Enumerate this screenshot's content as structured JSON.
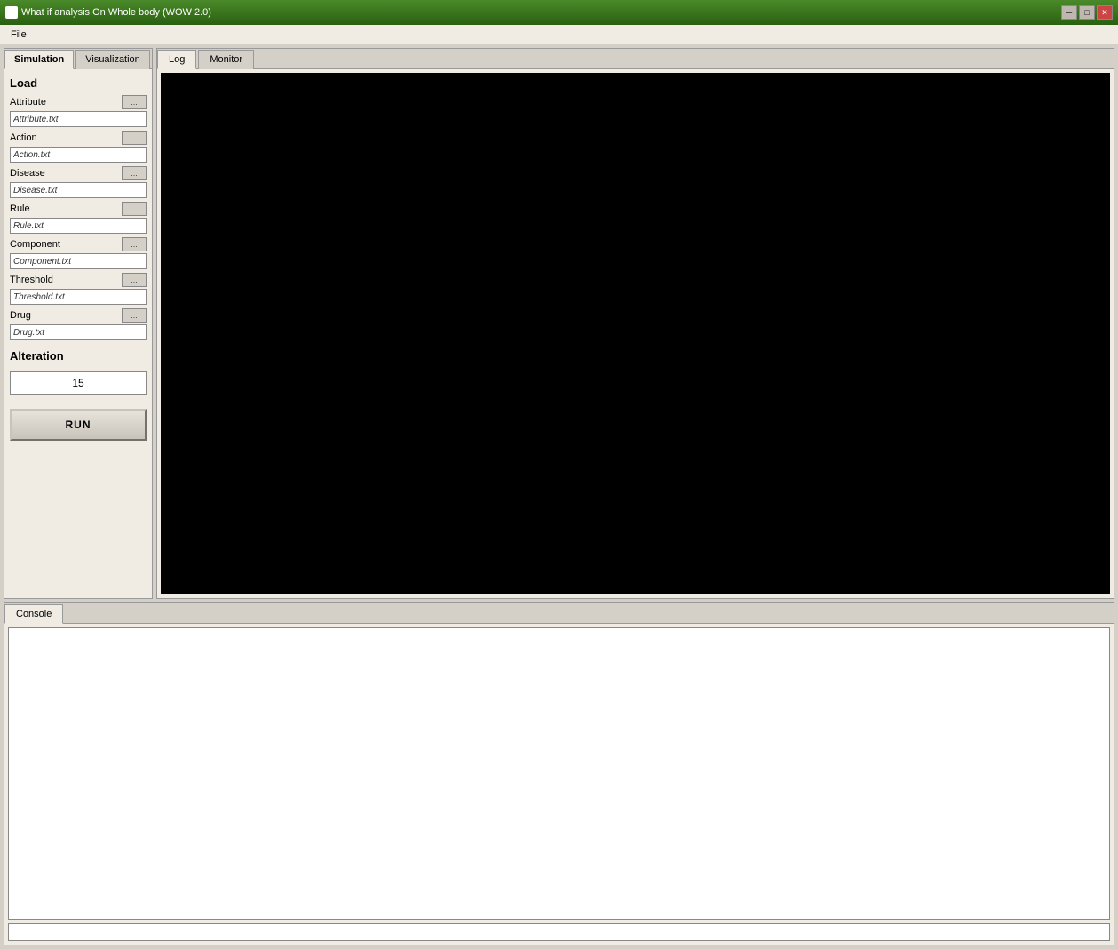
{
  "window": {
    "title": "What if analysis On Whole body (WOW 2.0)",
    "icon": "app-icon"
  },
  "titlebar": {
    "minimize_label": "─",
    "maximize_label": "□",
    "close_label": "✕"
  },
  "menubar": {
    "file_label": "File"
  },
  "left_panel": {
    "tabs": [
      {
        "id": "simulation",
        "label": "Simulation",
        "active": true
      },
      {
        "id": "visualization",
        "label": "Visualization",
        "active": false
      }
    ],
    "load_section": {
      "title": "Load",
      "fields": [
        {
          "id": "attribute",
          "label": "Attribute",
          "value": "Attribute.txt",
          "browse": "..."
        },
        {
          "id": "action",
          "label": "Action",
          "value": "Action.txt",
          "browse": "..."
        },
        {
          "id": "disease",
          "label": "Disease",
          "value": "Disease.txt",
          "browse": "..."
        },
        {
          "id": "rule",
          "label": "Rule",
          "value": "Rule.txt",
          "browse": "..."
        },
        {
          "id": "component",
          "label": "Component",
          "value": "Component.txt",
          "browse": "..."
        },
        {
          "id": "threshold",
          "label": "Threshold",
          "value": "Threshold.txt",
          "browse": "..."
        },
        {
          "id": "drug",
          "label": "Drug",
          "value": "Drug.txt",
          "browse": "..."
        }
      ]
    },
    "alteration_section": {
      "title": "Alteration",
      "value": "15"
    },
    "run_button_label": "RUN"
  },
  "right_panel": {
    "tabs": [
      {
        "id": "log",
        "label": "Log",
        "active": true
      },
      {
        "id": "monitor",
        "label": "Monitor",
        "active": false
      }
    ]
  },
  "console_panel": {
    "tab_label": "Console",
    "textarea_value": "",
    "input_value": ""
  }
}
